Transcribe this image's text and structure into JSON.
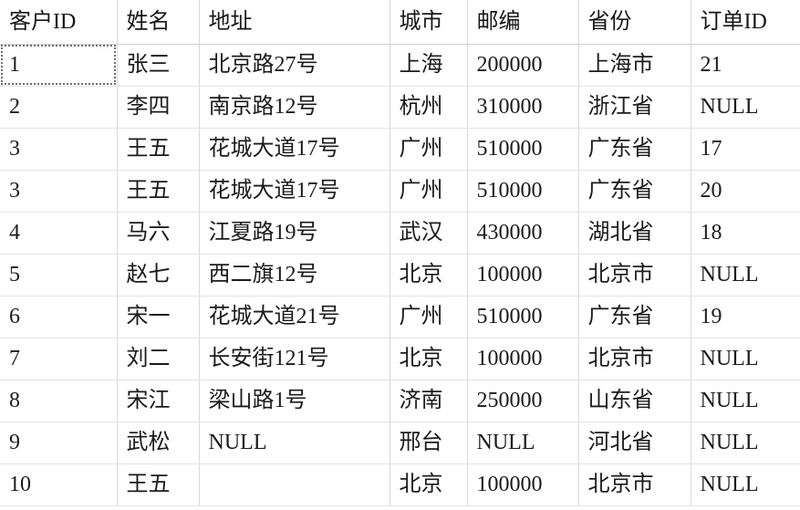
{
  "grid": {
    "columns": [
      {
        "key": "customer_id",
        "label": "客户ID"
      },
      {
        "key": "name",
        "label": "姓名"
      },
      {
        "key": "address",
        "label": "地址"
      },
      {
        "key": "city",
        "label": "城市"
      },
      {
        "key": "zip",
        "label": "邮编"
      },
      {
        "key": "province",
        "label": "省份"
      },
      {
        "key": "order_id",
        "label": "订单ID"
      }
    ],
    "null_token": "NULL",
    "colors": {
      "null_cell_background": "#fdfde3",
      "selected_cell_background": "#dfe6ec",
      "selected_cell_border": "#6d6d6d",
      "grid_line": "#d9d9d9",
      "header_rule": "#cfcfcf",
      "text": "#1b1b1b",
      "page_background": "#ffffff"
    },
    "selected_cell": {
      "row": 0,
      "column": "customer_id"
    },
    "rows": [
      {
        "customer_id": "1",
        "name": "张三",
        "address": "北京路27号",
        "city": "上海",
        "zip": "200000",
        "province": "上海市",
        "order_id": "21"
      },
      {
        "customer_id": "2",
        "name": "李四",
        "address": "南京路12号",
        "city": "杭州",
        "zip": "310000",
        "province": "浙江省",
        "order_id": "NULL"
      },
      {
        "customer_id": "3",
        "name": "王五",
        "address": "花城大道17号",
        "city": "广州",
        "zip": "510000",
        "province": "广东省",
        "order_id": "17"
      },
      {
        "customer_id": "3",
        "name": "王五",
        "address": "花城大道17号",
        "city": "广州",
        "zip": "510000",
        "province": "广东省",
        "order_id": "20"
      },
      {
        "customer_id": "4",
        "name": "马六",
        "address": "江夏路19号",
        "city": "武汉",
        "zip": "430000",
        "province": "湖北省",
        "order_id": "18"
      },
      {
        "customer_id": "5",
        "name": "赵七",
        "address": "西二旗12号",
        "city": "北京",
        "zip": "100000",
        "province": "北京市",
        "order_id": "NULL"
      },
      {
        "customer_id": "6",
        "name": "宋一",
        "address": "花城大道21号",
        "city": "广州",
        "zip": "510000",
        "province": "广东省",
        "order_id": "19"
      },
      {
        "customer_id": "7",
        "name": "刘二",
        "address": "长安街121号",
        "city": "北京",
        "zip": "100000",
        "province": "北京市",
        "order_id": "NULL"
      },
      {
        "customer_id": "8",
        "name": "宋江",
        "address": "梁山路1号",
        "city": "济南",
        "zip": "250000",
        "province": "山东省",
        "order_id": "NULL"
      },
      {
        "customer_id": "9",
        "name": "武松",
        "address": "NULL",
        "city": "邢台",
        "zip": "NULL",
        "province": "河北省",
        "order_id": "NULL"
      },
      {
        "customer_id": "10",
        "name": "王五",
        "address": "",
        "city": "北京",
        "zip": "100000",
        "province": "北京市",
        "order_id": "NULL"
      }
    ]
  }
}
